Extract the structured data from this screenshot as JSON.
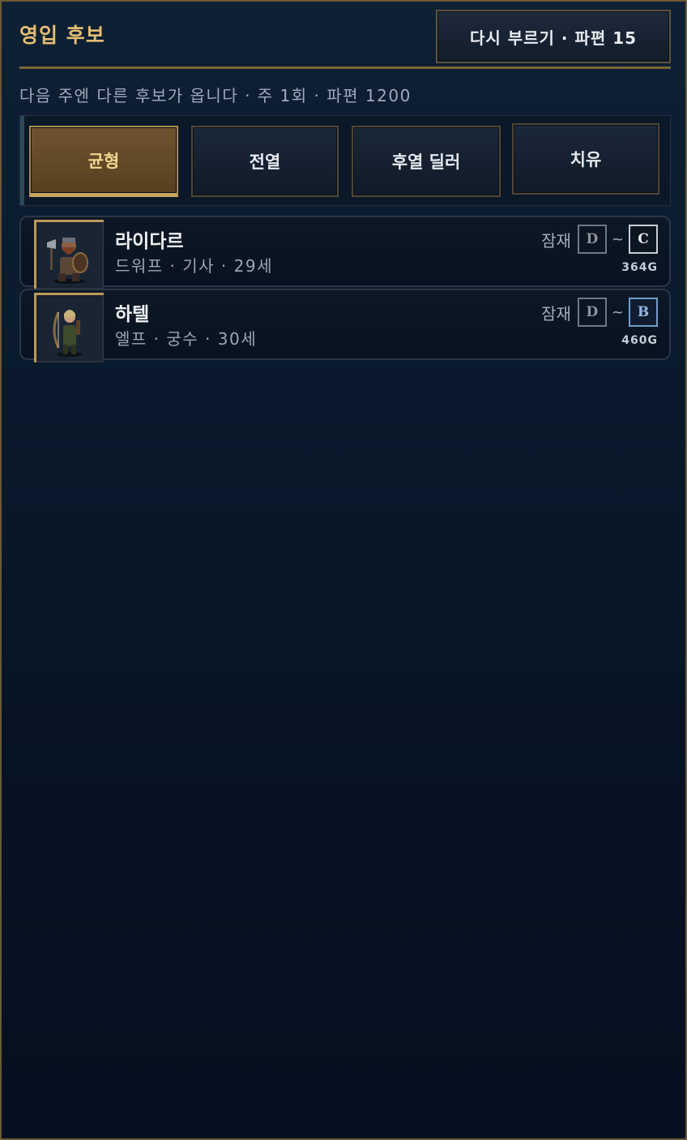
{
  "header": {
    "title": "영입 후보",
    "reroll_button": "다시 부르기 · 파편 15"
  },
  "subtitle": "다음 주엔 다른 후보가 옵니다 · 주 1회 · 파편 1200",
  "filters": [
    {
      "label": "균형",
      "active": true
    },
    {
      "label": "전열",
      "active": false
    },
    {
      "label": "후열 딜러",
      "active": false
    },
    {
      "label": "치유",
      "active": false
    }
  ],
  "candidates": [
    {
      "name": "라이다르",
      "meta": "드워프 · 기사 · 29세",
      "potential_label": "잠재",
      "grade_min": "D",
      "tilde": "~",
      "grade_max": "C",
      "price": "364G",
      "portrait_icon": "dwarf-knight-portrait"
    },
    {
      "name": "하텔",
      "meta": "엘프 · 궁수 · 30세",
      "potential_label": "잠재",
      "grade_min": "D",
      "tilde": "~",
      "grade_max": "B",
      "price": "460G",
      "portrait_icon": "elf-archer-portrait"
    }
  ],
  "colors": {
    "accent_gold": "#e2bd74",
    "active_filter": "#6f5330",
    "grade_b": "#8fb8e2",
    "background": "#0a1524"
  }
}
